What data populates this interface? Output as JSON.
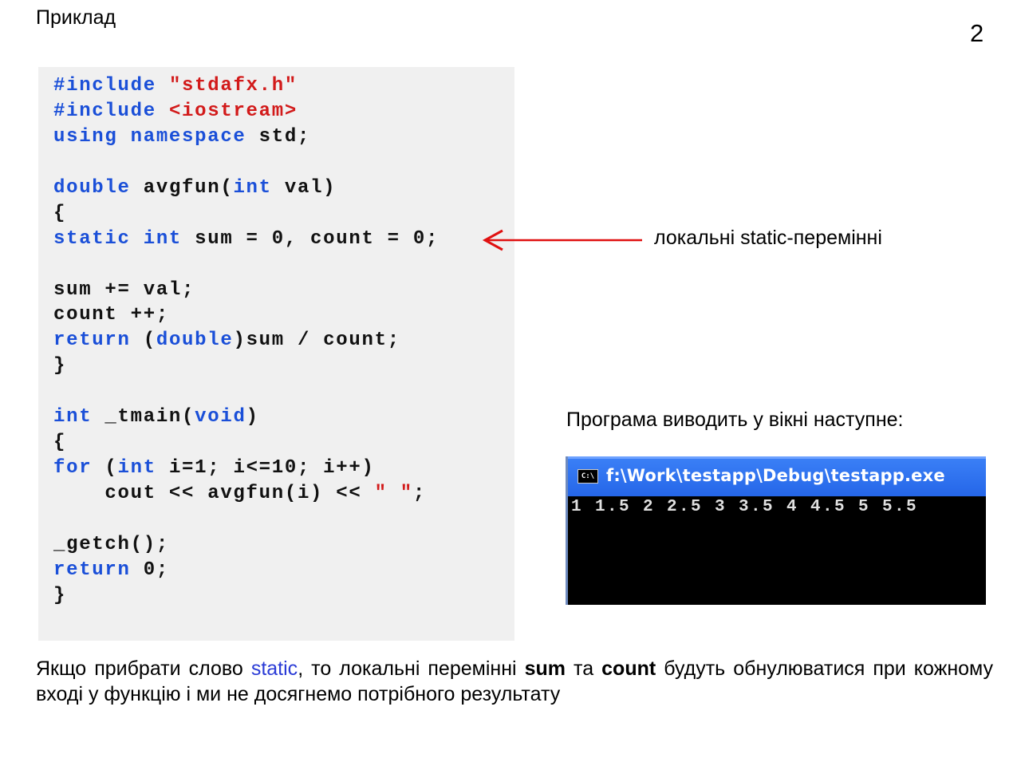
{
  "title": "Приклад",
  "page_number": "2",
  "code": {
    "l1_kw": "#include",
    "l1_str": "\"stdafx.h\"",
    "l2_kw": "#include",
    "l2_str": "<iostream>",
    "l3_kw": "using namespace",
    "l3_rest": "std;",
    "l5_kw": "double",
    "l5_a": "avgfun(",
    "l5_kw2": "int",
    "l5_b": "val)",
    "l6": "{",
    "l7_kw": "static int",
    "l7_rest": "sum = 0, count = 0;",
    "l9": "sum += val;",
    "l10": "count ++;",
    "l11_kw": "return",
    "l11_a": "(",
    "l11_kw2": "double",
    "l11_b": ")sum / count;",
    "l12": "}",
    "l14_kw": "int",
    "l14_a": "_tmain(",
    "l14_kw2": "void",
    "l14_b": ")",
    "l15": "{",
    "l16_kw": "for",
    "l16_a": "(",
    "l16_kw2": "int",
    "l16_b": "i=1; i<=10; i++)",
    "l17_a": "    cout << avgfun(i) <<",
    "l17_str": "\" \"",
    "l17_b": ";",
    "l19": "_getch();",
    "l20_kw": "return",
    "l20_rest": "0;",
    "l21": "}"
  },
  "annotation": "локальні static-перемінні",
  "output_caption": "Програма виводить у вікні наступне:",
  "console": {
    "icon_text": "C:\\",
    "title": "f:\\Work\\testapp\\Debug\\testapp.exe",
    "output": "1 1.5 2 2.5 3 3.5 4 4.5 5 5.5"
  },
  "footer": {
    "p1": "Якщо прибрати слово",
    "kw": "static",
    "p2": ", то локальні перемінні",
    "b1": "sum",
    "p3": "та",
    "b2": "count",
    "p4": " будуть обнулюватися при кожному вході у функцію і ми не досягнемо потрібного результату"
  },
  "colors": {
    "keyword": "#1a4fd8",
    "string": "#d21a1a",
    "arrow": "#e01010",
    "console_titlebar": "#2566e8",
    "code_background": "#f0f0f0"
  }
}
